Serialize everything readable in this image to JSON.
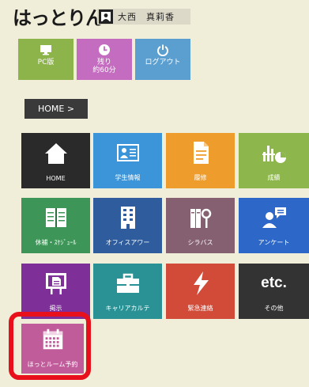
{
  "header": {
    "logo_text": "はっとりん",
    "user_name": "大西　真莉香"
  },
  "top_buttons": [
    {
      "name": "pc-version",
      "label": "PC版",
      "color": "#8db44b",
      "icon": "monitor-icon"
    },
    {
      "name": "remaining-time",
      "label_line1": "残り",
      "label_line2": "約60分",
      "color": "#c46cbf",
      "icon": "clock-icon"
    },
    {
      "name": "logout",
      "label": "ログアウト",
      "color": "#5b9fd0",
      "icon": "power-icon"
    }
  ],
  "breadcrumb": {
    "label": "HOME >"
  },
  "tiles": [
    {
      "name": "home",
      "label": "HOME",
      "color": "#2a2a2a",
      "icon": "home-icon"
    },
    {
      "name": "student-info",
      "label": "学生情報",
      "color": "#3c95d8",
      "icon": "id-card-icon"
    },
    {
      "name": "courses",
      "label": "履修",
      "color": "#ee9d2c",
      "icon": "document-icon"
    },
    {
      "name": "grades",
      "label": "成績",
      "color": "#8db64c",
      "icon": "chart-icon"
    },
    {
      "name": "absence-schedule",
      "label": "休補・ｽｹｼﾞｭｰﾙ",
      "color": "#3e9558",
      "icon": "notebook-icon"
    },
    {
      "name": "office-hours",
      "label": "オフィスアワー",
      "color": "#2e5c9c",
      "icon": "building-icon"
    },
    {
      "name": "syllabus",
      "label": "シラバス",
      "color": "#856070",
      "icon": "books-icon"
    },
    {
      "name": "survey",
      "label": "アンケート",
      "color": "#2d67c8",
      "icon": "person-speech-icon"
    },
    {
      "name": "notice",
      "label": "掲示",
      "color": "#7e2f98",
      "icon": "board-icon"
    },
    {
      "name": "career",
      "label": "キャリアカルテ",
      "color": "#2a9194",
      "icon": "briefcase-icon"
    },
    {
      "name": "emergency",
      "label": "緊急連絡",
      "color": "#d24a38",
      "icon": "lightning-icon"
    },
    {
      "name": "other",
      "label": "その他",
      "color": "#333333",
      "icon": "etc-icon",
      "icon_text": "etc."
    },
    {
      "name": "room-booking",
      "label": "ほっとルーム予約",
      "color": "#c05c9a",
      "icon": "calendar-icon"
    }
  ],
  "highlight": {
    "color": "#e8101a"
  }
}
